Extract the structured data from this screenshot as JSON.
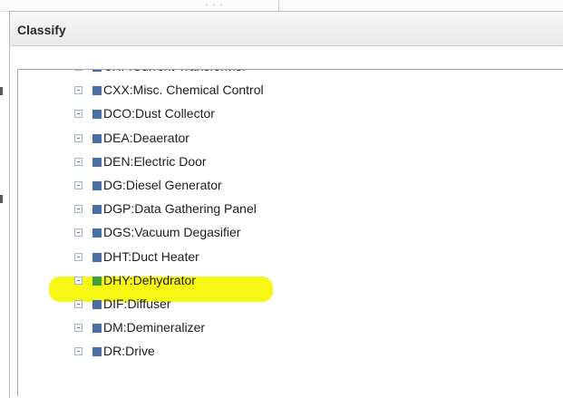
{
  "dialog": {
    "title": "Classify"
  },
  "colors": {
    "item_icon": "#4a6ea3",
    "selected_icon": "#3f9f35",
    "highlight": "#f6f600"
  },
  "tree": {
    "items": [
      {
        "label": "CXF:Current Transformer",
        "selected": false
      },
      {
        "label": "CXX:Misc. Chemical Control",
        "selected": false
      },
      {
        "label": "DCO:Dust Collector",
        "selected": false
      },
      {
        "label": "DEA:Deaerator",
        "selected": false
      },
      {
        "label": "DEN:Electric Door",
        "selected": false
      },
      {
        "label": "DG:Diesel Generator",
        "selected": false
      },
      {
        "label": "DGP:Data Gathering Panel",
        "selected": false
      },
      {
        "label": "DGS:Vacuum Degasifier",
        "selected": false
      },
      {
        "label": "DHT:Duct Heater",
        "selected": false
      },
      {
        "label": "DHY:Dehydrator",
        "selected": true
      },
      {
        "label": "DIF:Diffuser",
        "selected": false
      },
      {
        "label": "DM:Demineralizer",
        "selected": false
      },
      {
        "label": "DR:Drive",
        "selected": false
      }
    ]
  }
}
